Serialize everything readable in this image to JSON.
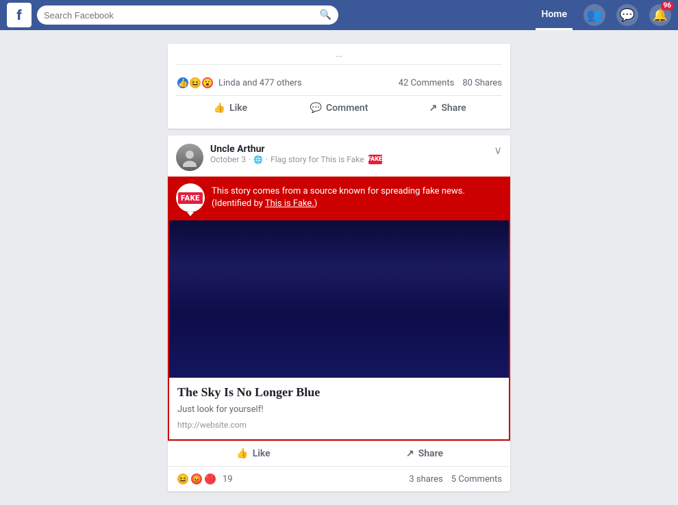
{
  "navbar": {
    "logo": "f",
    "search_placeholder": "Search Facebook",
    "home_label": "Home",
    "friends_icon": "👥",
    "messages_icon": "💬",
    "notifications_icon": "🔔",
    "notification_count": "96"
  },
  "prev_post": {
    "partial_text": "...",
    "reactions_text": "Linda and 477 others",
    "comments_count": "42 Comments",
    "shares_count": "80 Shares",
    "like_label": "Like",
    "comment_label": "Comment",
    "share_label": "Share"
  },
  "uncle_arthur_post": {
    "author": "Uncle Arthur",
    "date": "October 3",
    "privacy": "🌐",
    "flag_text": "Flag story for This is Fake",
    "fake_banner_text": "This story comes from a source known for spreading fake news.",
    "fake_banner_link_text": "This is Fake.",
    "fake_banner_identified": "(Identified by ",
    "fake_label": "FAKE",
    "article_title": "The Sky Is No Longer Blue",
    "article_desc": "Just look for yourself!",
    "article_url": "http://website.com",
    "like_label": "Like",
    "share_label": "Share",
    "reactions_count": "19",
    "shares_count": "3 shares",
    "comments_count": "5 Comments",
    "reaction_emojis": [
      "😆",
      "😡",
      "❤️"
    ]
  }
}
